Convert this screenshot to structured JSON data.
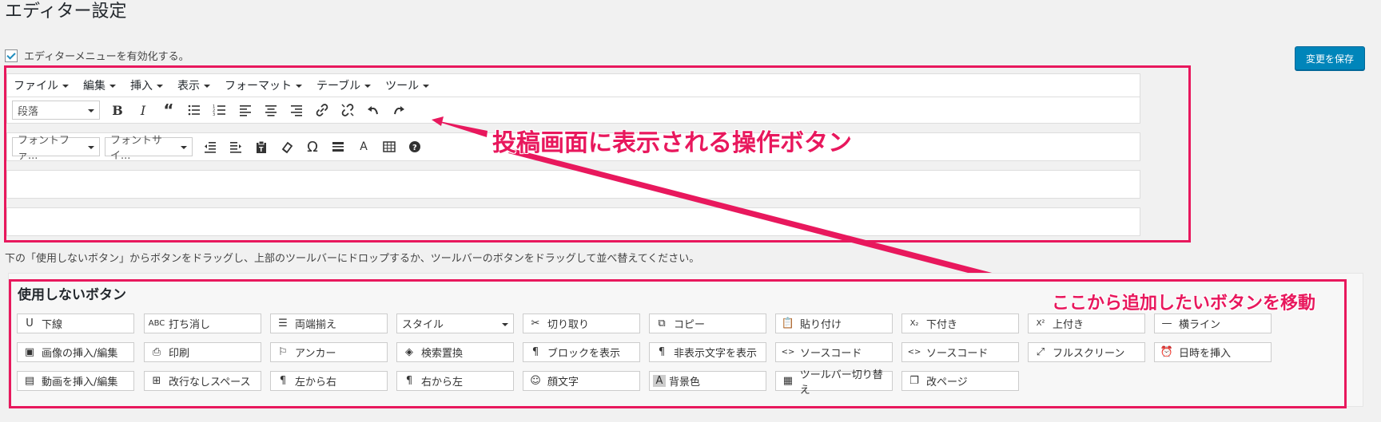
{
  "page": {
    "title": "エディター設定",
    "enable_label": "エディターメニューを有効化する。",
    "save_label": "変更を保存",
    "hint": "下の「使用しないボタン」からボタンをドラッグし、上部のツールバーにドロップするか、ツールバーのボタンをドラッグして並べ替えてください。"
  },
  "menubar": [
    "ファイル",
    "編集",
    "挿入",
    "表示",
    "フォーマット",
    "テーブル",
    "ツール"
  ],
  "row1": {
    "format_select": "段落",
    "icons": [
      "bold-icon",
      "italic-icon",
      "blockquote-icon",
      "bullet-list-icon",
      "numbered-list-icon",
      "align-left-icon",
      "align-center-icon",
      "align-right-icon",
      "link-icon",
      "unlink-icon",
      "undo-icon",
      "redo-icon"
    ]
  },
  "row2": {
    "font_family_select": "フォントファ...",
    "font_size_select": "フォントサイ...",
    "icons": [
      "outdent-icon",
      "indent-icon",
      "paste-text-icon",
      "clear-format-icon",
      "omega-icon",
      "horizontal-rule-icon",
      "text-color-icon",
      "table-icon",
      "help-icon"
    ]
  },
  "annotations": {
    "toolbar_label": "投稿画面に表示される操作ボタン",
    "move_label": "ここから追加したいボタンを移動",
    "color": "#e8185d"
  },
  "unused": {
    "title": "使用しないボタン",
    "rows": [
      [
        {
          "icon": "U",
          "label": "下線"
        },
        {
          "icon": "ABC",
          "label": "打ち消し"
        },
        {
          "icon": "☰",
          "label": "両端揃え"
        },
        {
          "icon": "",
          "label": "スタイル",
          "select": true
        },
        {
          "icon": "✂",
          "label": "切り取り"
        },
        {
          "icon": "⧉",
          "label": "コピー"
        },
        {
          "icon": "📋",
          "label": "貼り付け"
        },
        {
          "icon": "X₂",
          "label": "下付き"
        },
        {
          "icon": "X²",
          "label": "上付き"
        },
        {
          "icon": "—",
          "label": "横ライン"
        }
      ],
      [
        {
          "icon": "▣",
          "label": "画像の挿入/編集"
        },
        {
          "icon": "⎙",
          "label": "印刷"
        },
        {
          "icon": "⚐",
          "label": "アンカー"
        },
        {
          "icon": "◈",
          "label": "検索置換"
        },
        {
          "icon": "¶",
          "label": "ブロックを表示"
        },
        {
          "icon": "¶",
          "label": "非表示文字を表示"
        },
        {
          "icon": "<>",
          "label": "ソースコード"
        },
        {
          "icon": "<>",
          "label": "ソースコード"
        },
        {
          "icon": "⤢",
          "label": "フルスクリーン"
        },
        {
          "icon": "⏰",
          "label": "日時を挿入"
        }
      ],
      [
        {
          "icon": "▤",
          "label": "動画を挿入/編集"
        },
        {
          "icon": "⊞",
          "label": "改行なしスペース"
        },
        {
          "icon": "¶",
          "label": "左から右"
        },
        {
          "icon": "¶",
          "label": "右から左"
        },
        {
          "icon": "☺",
          "label": "顔文字"
        },
        {
          "icon": "A",
          "label": "背景色"
        },
        {
          "icon": "▦",
          "label": "ツールバー切り替え"
        },
        {
          "icon": "❐",
          "label": "改ページ"
        }
      ]
    ]
  }
}
